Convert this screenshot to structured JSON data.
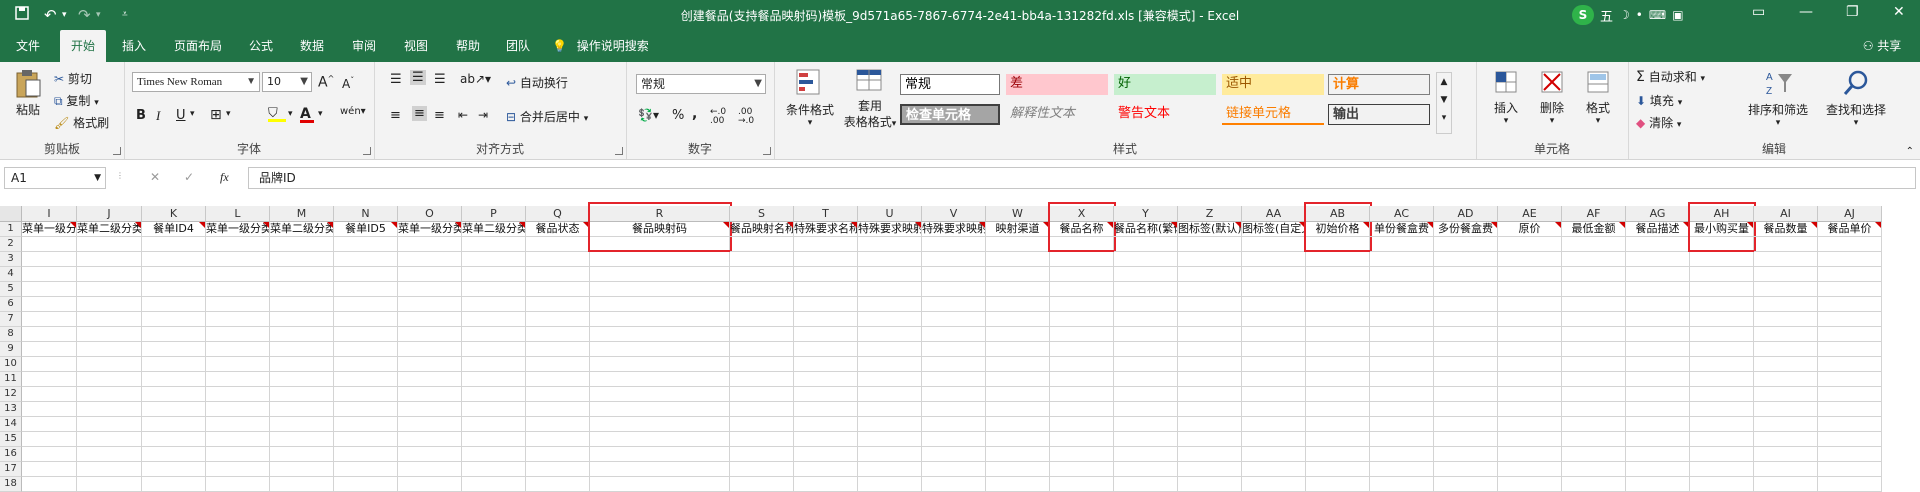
{
  "window": {
    "title": "创建餐品(支持餐品映射码)模板_9d571a65-7867-6774-2e41-bb4a-131282fd.xls  [兼容模式] - Excel",
    "user_badge": "五",
    "icons": [
      "save-icon",
      "undo-icon",
      "redo-icon",
      "customize-icon",
      "minimize-icon",
      "maximize-icon",
      "close-icon"
    ]
  },
  "menu": {
    "tabs": [
      "文件",
      "开始",
      "插入",
      "页面布局",
      "公式",
      "数据",
      "审阅",
      "视图",
      "帮助",
      "团队"
    ],
    "active": "开始",
    "tell_me": "操作说明搜索",
    "share": "共享"
  },
  "ribbon": {
    "clipboard": {
      "paste": "粘贴",
      "cut": "剪切",
      "copy": "复制",
      "format_painter": "格式刷",
      "label": "剪贴板"
    },
    "font": {
      "name": "Times New Roman",
      "size": "10",
      "bold": "B",
      "italic": "I",
      "underline": "U",
      "label": "字体",
      "grow": "A",
      "shrink": "A",
      "font_color": "A"
    },
    "alignment": {
      "wrap": "自动换行",
      "merge": "合并后居中",
      "label": "对齐方式"
    },
    "number": {
      "format": "常规",
      "percent": "%",
      "comma": ",",
      "label": "数字"
    },
    "styles": {
      "conditional": "条件格式",
      "table_line1": "套用",
      "table_line2": "表格格式",
      "cells": [
        "常规",
        "差",
        "好",
        "适中",
        "计算",
        "检查单元格",
        "解释性文本",
        "警告文本",
        "链接单元格",
        "输出"
      ],
      "colors": {
        "bad_bg": "#ffc7ce",
        "bad_fg": "#9c0006",
        "good_bg": "#c6efce",
        "good_fg": "#006100",
        "neutral_bg": "#ffeb9c",
        "neutral_fg": "#9c5700",
        "calc_fg": "#fa7d00",
        "check_bg": "#a5a5a5",
        "warn_fg": "#ff0000"
      },
      "label": "样式"
    },
    "cells_group": {
      "insert": "插入",
      "delete": "删除",
      "format": "格式",
      "label": "单元格"
    },
    "editing": {
      "autosum": "自动求和",
      "fill": "填充",
      "clear": "清除",
      "sort": "排序和筛选",
      "find": "查找和选择",
      "label": "编辑"
    }
  },
  "formula_bar": {
    "name_box": "A1",
    "cancel": "✕",
    "enter": "✓",
    "fx": "fx",
    "content": "品牌ID"
  },
  "sheet": {
    "columns": [
      "I",
      "J",
      "K",
      "L",
      "M",
      "N",
      "O",
      "P",
      "Q",
      "R",
      "S",
      "T",
      "U",
      "V",
      "W",
      "X",
      "Y",
      "Z",
      "AA",
      "AB",
      "AC",
      "AD",
      "AE",
      "AF",
      "AG",
      "AH",
      "AI",
      "AJ"
    ],
    "row1": [
      "菜单一级分类",
      "菜单二级分类",
      "餐单ID4",
      "菜单一级分类",
      "菜单二级分类",
      "餐单ID5",
      "菜单一级分类",
      "菜单二级分类",
      "餐品状态",
      "餐品映射码",
      "餐品映射名称",
      "特殊要求名称",
      "特殊要求映射码",
      "特殊要求映射名",
      "映射渠道",
      "餐品名称",
      "餐品名称(繁体)",
      "图标签(默认)",
      "图标签(自定义)",
      "初始价格",
      "单份餐盒费",
      "多份餐盒费",
      "原价",
      "最低金额",
      "餐品描述",
      "最小购买量",
      "餐品数量",
      "餐品单价"
    ],
    "rows": [
      "1",
      "2",
      "3",
      "4",
      "5",
      "6",
      "7",
      "8",
      "9",
      "10",
      "11",
      "12",
      "13",
      "14",
      "15",
      "16",
      "17",
      "18"
    ],
    "highlight_color": "#e3242b"
  }
}
